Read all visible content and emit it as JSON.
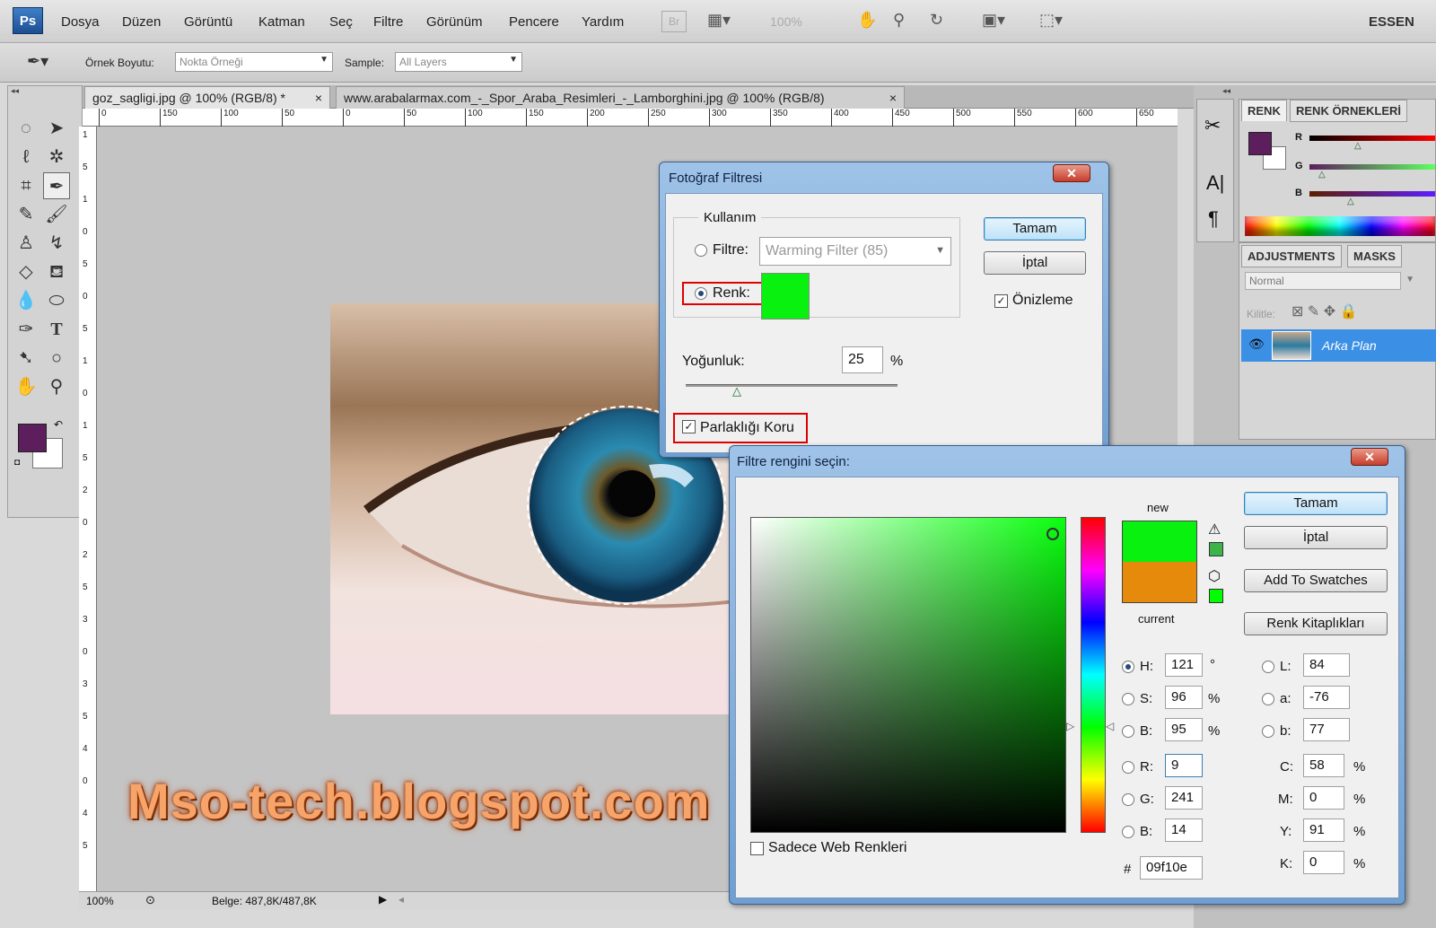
{
  "app": {
    "logo": "Ps",
    "workspace": "ESSEN"
  },
  "menu": [
    "Dosya",
    "Düzen",
    "Görüntü",
    "Katman",
    "Seç",
    "Filtre",
    "Görünüm",
    "Pencere",
    "Yardım"
  ],
  "toolbar": {
    "br": "Br",
    "zoom": "100%"
  },
  "options": {
    "sample_size_label": "Örnek Boyutu:",
    "sample_size_value": "Nokta Örneği",
    "sample_label": "Sample:",
    "sample_value": "All Layers"
  },
  "tabs": [
    {
      "label": "goz_sagligi.jpg @ 100% (RGB/8) *",
      "close": "×"
    },
    {
      "label": "www.arabalarmax.com_-_Spor_Araba_Resimleri_-_Lamborghini.jpg @ 100% (RGB/8)",
      "close": "×"
    }
  ],
  "ruler": {
    "h_ticks": [
      "0",
      "150",
      "100",
      "50",
      "0",
      "50",
      "100",
      "150",
      "200",
      "250",
      "300",
      "350",
      "400",
      "450",
      "500",
      "550",
      "600",
      "650"
    ],
    "v_ticks": [
      "1",
      "5",
      "1",
      "0",
      "5",
      "0",
      "5",
      "1",
      "0",
      "1",
      "5",
      "2",
      "0",
      "2",
      "5",
      "3",
      "0",
      "3",
      "5",
      "4",
      "0",
      "4",
      "5"
    ]
  },
  "status": {
    "zoom": "100%",
    "doc": "Belge: 487,8K/487,8K"
  },
  "colors": {
    "foreground": "#5d1e5e",
    "background": "#ffffff",
    "new": "#09f10e",
    "current": "#e58a0b"
  },
  "color_panel": {
    "tabs": [
      "RENK",
      "RENK ÖRNEKLERİ"
    ],
    "channels": [
      "R",
      "G",
      "B"
    ]
  },
  "layers_panel": {
    "tabs": [
      "ADJUSTMENTS",
      "MASKS"
    ],
    "blend": "Normal",
    "lock_label": "Kilitle:",
    "layer_name": "Arka Plan"
  },
  "photo_filter": {
    "title": "Fotoğraf Filtresi",
    "close": "✕",
    "group": "Kullanım",
    "filter_label": "Filtre:",
    "filter_value": "Warming Filter (85)",
    "color_label": "Renk:",
    "density_label": "Yoğunluk:",
    "density_value": "25",
    "percent": "%",
    "luminosity_label": "Parlaklığı Koru",
    "ok": "Tamam",
    "cancel": "İptal",
    "preview": "Önizleme"
  },
  "color_picker": {
    "title": "Filtre rengini seçin:",
    "close": "✕",
    "new_label": "new",
    "current_label": "current",
    "ok": "Tamam",
    "cancel": "İptal",
    "add_swatches": "Add To Swatches",
    "libraries": "Renk Kitaplıkları",
    "web_only": "Sadece Web Renkleri",
    "hsb": [
      {
        "label": "H:",
        "value": "121",
        "unit": "°"
      },
      {
        "label": "S:",
        "value": "96",
        "unit": "%"
      },
      {
        "label": "B:",
        "value": "95",
        "unit": "%"
      }
    ],
    "rgb": [
      {
        "label": "R:",
        "value": "9"
      },
      {
        "label": "G:",
        "value": "241"
      },
      {
        "label": "B:",
        "value": "14"
      }
    ],
    "lab": [
      {
        "label": "L:",
        "value": "84"
      },
      {
        "label": "a:",
        "value": "-76"
      },
      {
        "label": "b:",
        "value": "77"
      }
    ],
    "cmyk": [
      {
        "label": "C:",
        "value": "58",
        "unit": "%"
      },
      {
        "label": "M:",
        "value": "0",
        "unit": "%"
      },
      {
        "label": "Y:",
        "value": "91",
        "unit": "%"
      },
      {
        "label": "K:",
        "value": "0",
        "unit": "%"
      }
    ],
    "hex_label": "#",
    "hex": "09f10e"
  },
  "watermark": "Mso-tech.blogspot.com"
}
